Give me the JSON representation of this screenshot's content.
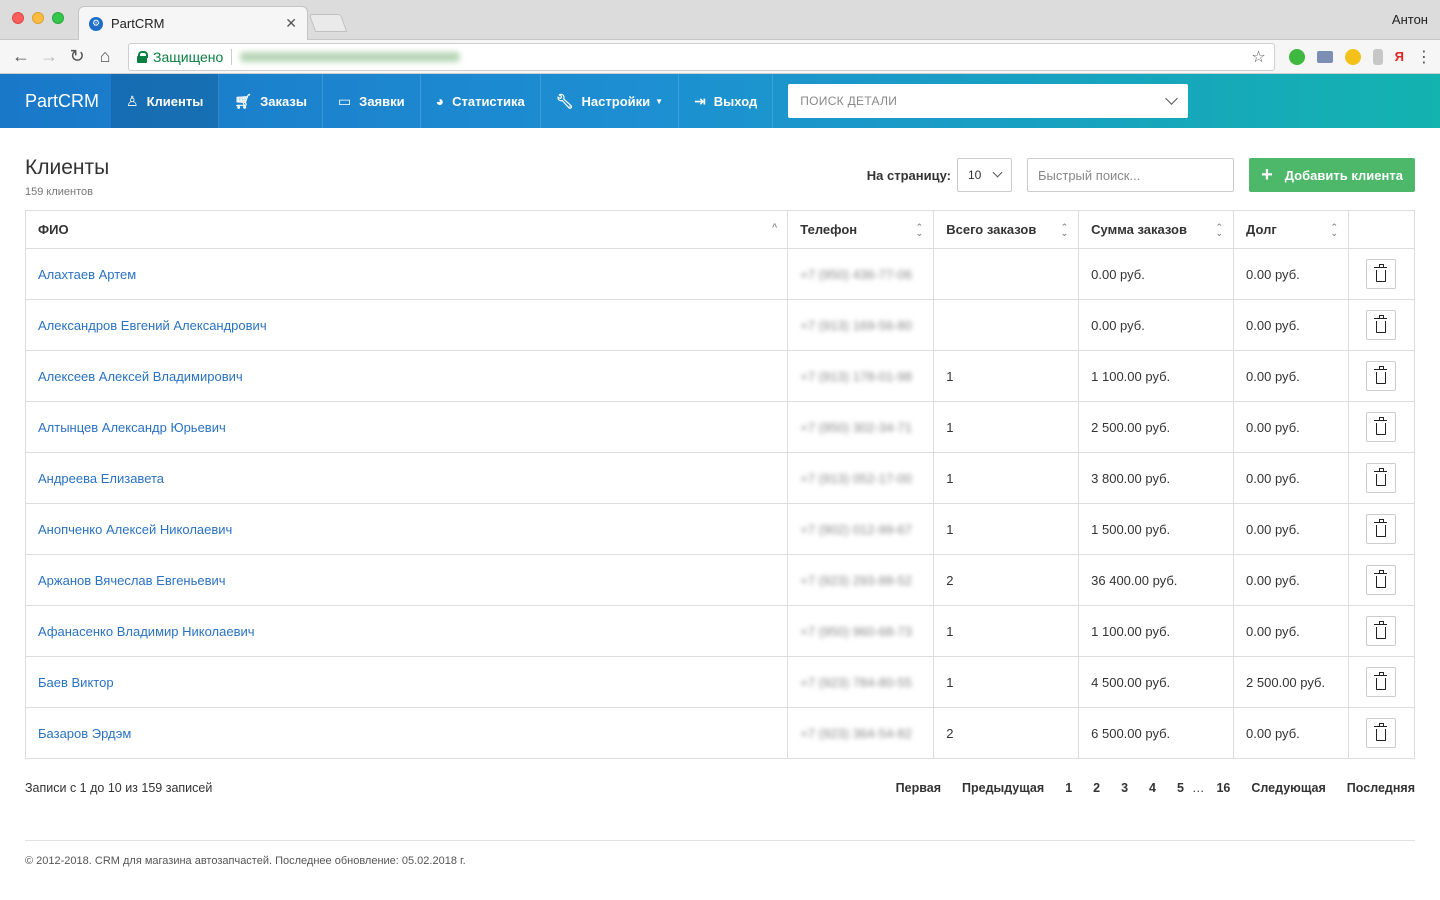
{
  "browser": {
    "tab_title": "PartCRM",
    "tab_close": "✕",
    "profile": "Антон",
    "secure_label": "Защищено"
  },
  "nav": {
    "brand": "PartCRM",
    "items": [
      {
        "label": "Клиенты",
        "icon": "user-icon"
      },
      {
        "label": "Заказы",
        "icon": "cart-icon"
      },
      {
        "label": "Заявки",
        "icon": "chat-icon"
      },
      {
        "label": "Статистика",
        "icon": "pie-chart-icon"
      },
      {
        "label": "Настройки",
        "icon": "wrench-icon"
      },
      {
        "label": "Выход",
        "icon": "logout-icon"
      }
    ],
    "search_placeholder": "ПОИСК ДЕТАЛИ"
  },
  "page": {
    "title": "Клиенты",
    "subtitle": "159 клиентов",
    "perpage_label": "На страницу:",
    "perpage_value": "10",
    "quick_search_placeholder": "Быстрый поиск...",
    "add_button": "Добавить клиента"
  },
  "table": {
    "headers": [
      "ФИО",
      "Телефон",
      "Всего заказов",
      "Сумма заказов",
      "Долг"
    ],
    "rows": [
      {
        "name": "Алахтаев Артем",
        "phone": "+7 (950) 436-77-06",
        "orders": "",
        "sum": "0.00 руб.",
        "debt": "0.00 руб."
      },
      {
        "name": "Александров Евгений Александрович",
        "phone": "+7 (913) 169-56-80",
        "orders": "",
        "sum": "0.00 руб.",
        "debt": "0.00 руб."
      },
      {
        "name": "Алексеев Алексей Владимирович",
        "phone": "+7 (913) 178-01-98",
        "orders": "1",
        "sum": "1 100.00 руб.",
        "debt": "0.00 руб."
      },
      {
        "name": "Алтынцев Александр Юрьевич",
        "phone": "+7 (950) 302-34-71",
        "orders": "1",
        "sum": "2 500.00 руб.",
        "debt": "0.00 руб."
      },
      {
        "name": "Андреева Елизавета",
        "phone": "+7 (913) 052-17-00",
        "orders": "1",
        "sum": "3 800.00 руб.",
        "debt": "0.00 руб."
      },
      {
        "name": "Анопченко Алексей Николаевич",
        "phone": "+7 (902) 012-99-67",
        "orders": "1",
        "sum": "1 500.00 руб.",
        "debt": "0.00 руб."
      },
      {
        "name": "Аржанов Вячеслав Евгеньевич",
        "phone": "+7 (923) 293-88-52",
        "orders": "2",
        "sum": "36 400.00 руб.",
        "debt": "0.00 руб."
      },
      {
        "name": "Афанасенко Владимир Николаевич",
        "phone": "+7 (950) 960-68-73",
        "orders": "1",
        "sum": "1 100.00 руб.",
        "debt": "0.00 руб."
      },
      {
        "name": "Баев Виктор",
        "phone": "+7 (923) 784-80-55",
        "orders": "1",
        "sum": "4 500.00 руб.",
        "debt": "2 500.00 руб."
      },
      {
        "name": "Базаров Эрдэм",
        "phone": "+7 (923) 364-54-82",
        "orders": "2",
        "sum": "6 500.00 руб.",
        "debt": "0.00 руб."
      }
    ]
  },
  "pagination": {
    "records": "Записи с 1 до 10 из 159 записей",
    "first": "Первая",
    "prev": "Предыдущая",
    "pages": [
      "1",
      "2",
      "3",
      "4",
      "5"
    ],
    "ellipsis": "…",
    "last_page": "16",
    "next": "Следующая",
    "last": "Последняя"
  },
  "footer": {
    "text": "© 2012-2018. CRM для магазина автозапчастей. Последнее обновление: 05.02.2018 г."
  }
}
